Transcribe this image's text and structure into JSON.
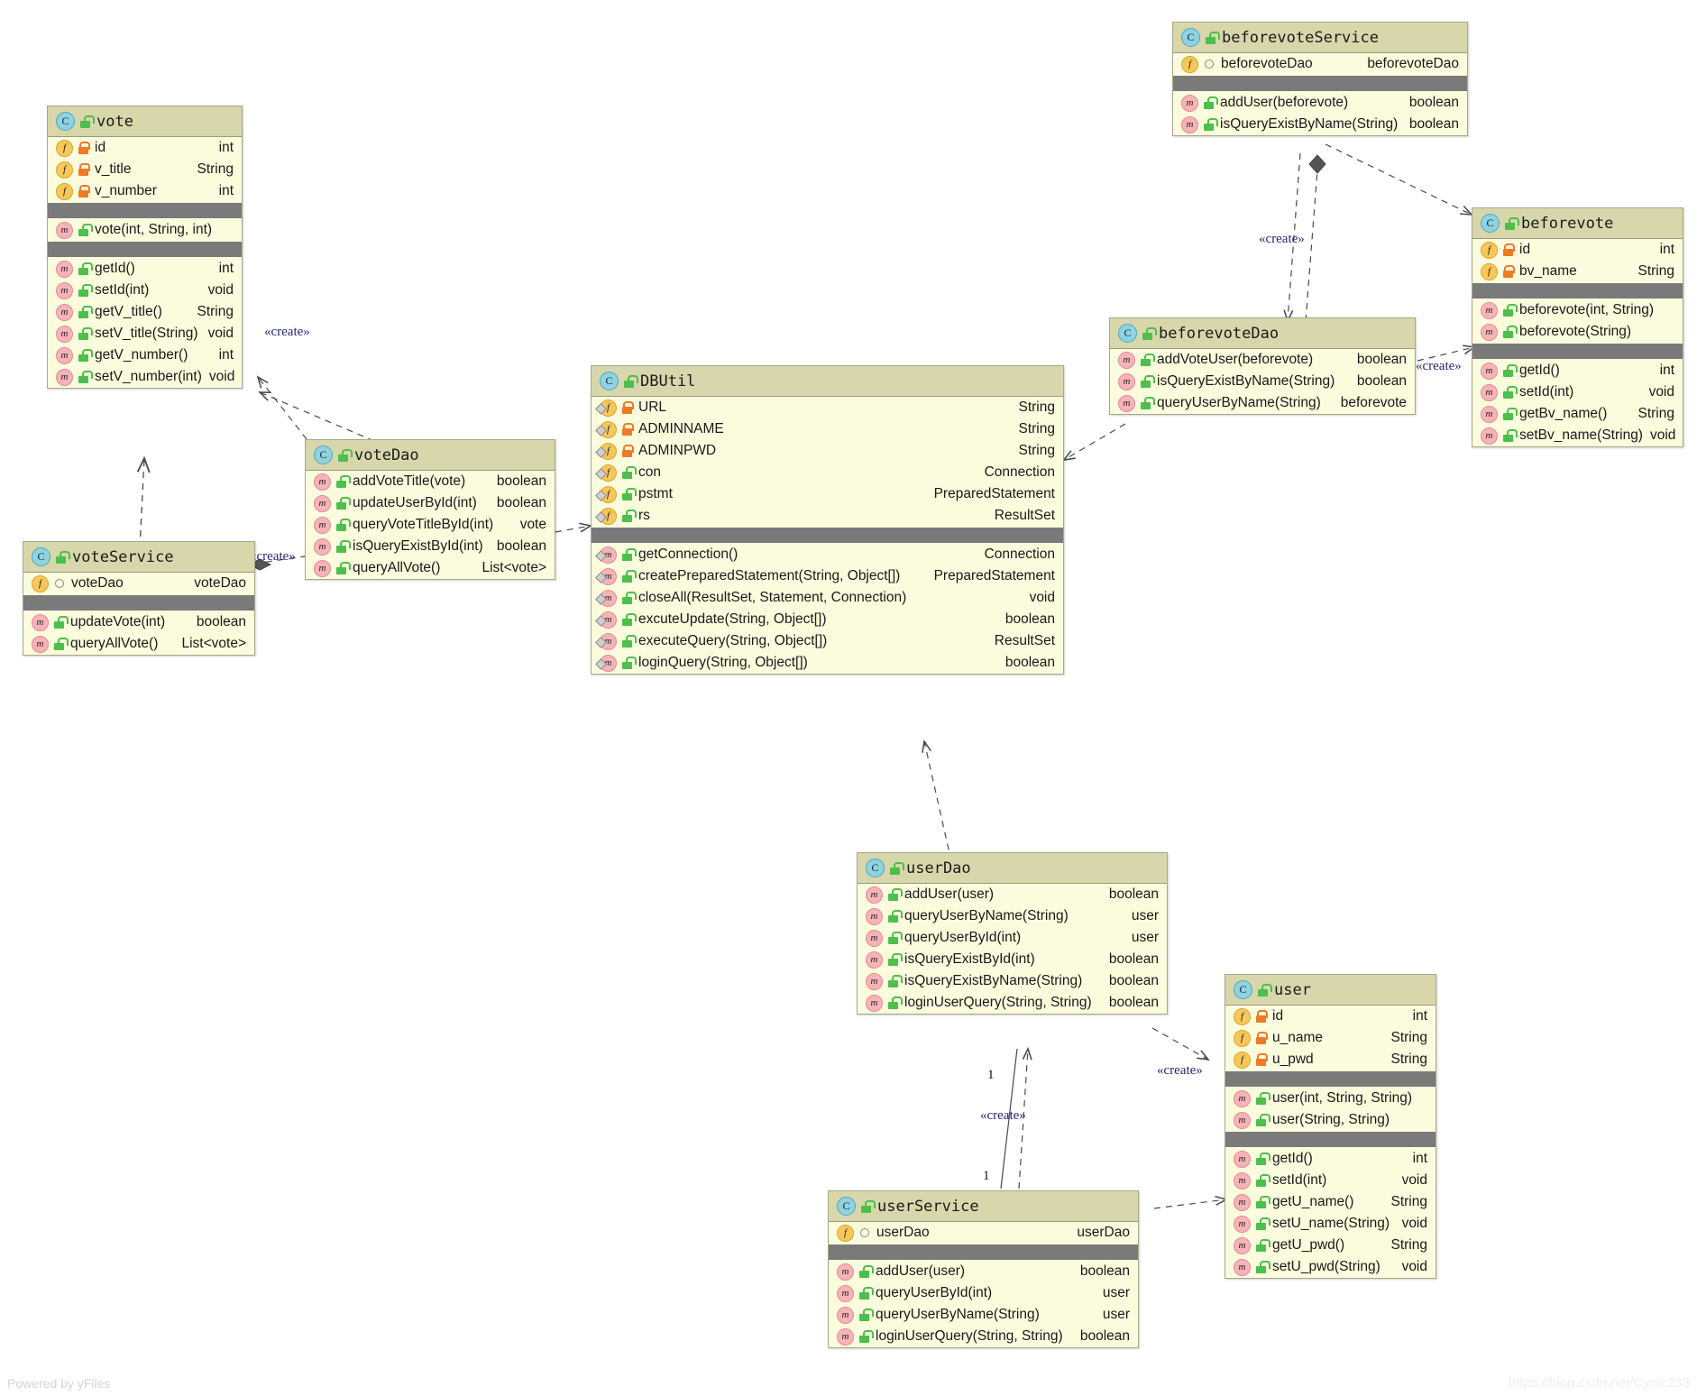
{
  "diagram": {
    "kind": "uml-class-diagram",
    "footer_left": "Powered by yFiles",
    "watermark": "https://blog.csdn.net/Cynic233",
    "colors": {
      "class_header": "#d7d7ab",
      "class_body": "#fbfbdd",
      "separator": "#7a7a7a",
      "border": "#a8a88c",
      "stereotype_text": "#26267a",
      "class_icon": "#8fd3e0",
      "field_icon": "#f7c75a",
      "method_icon": "#f7b3b8",
      "public_lock": "#4cbf4c",
      "private_lock": "#f07a26"
    }
  },
  "classes": {
    "vote": {
      "name": "vote",
      "fields": [
        {
          "name": "id",
          "type": "int",
          "vis": "private"
        },
        {
          "name": "v_title",
          "type": "String",
          "vis": "private"
        },
        {
          "name": "v_number",
          "type": "int",
          "vis": "private"
        }
      ],
      "constructors": [
        {
          "name": "vote(int, String, int)",
          "type": "",
          "vis": "public"
        }
      ],
      "methods": [
        {
          "name": "getId()",
          "type": "int",
          "vis": "public"
        },
        {
          "name": "setId(int)",
          "type": "void",
          "vis": "public"
        },
        {
          "name": "getV_title()",
          "type": "String",
          "vis": "public"
        },
        {
          "name": "setV_title(String)",
          "type": "void",
          "vis": "public"
        },
        {
          "name": "getV_number()",
          "type": "int",
          "vis": "public"
        },
        {
          "name": "setV_number(int)",
          "type": "void",
          "vis": "public"
        }
      ]
    },
    "voteService": {
      "name": "voteService",
      "fields": [
        {
          "name": "voteDao",
          "type": "voteDao",
          "vis": "package"
        }
      ],
      "methods": [
        {
          "name": "updateVote(int)",
          "type": "boolean",
          "vis": "public"
        },
        {
          "name": "queryAllVote()",
          "type": "List<vote>",
          "vis": "public"
        }
      ]
    },
    "voteDao": {
      "name": "voteDao",
      "methods": [
        {
          "name": "addVoteTitle(vote)",
          "type": "boolean",
          "vis": "public"
        },
        {
          "name": "updateUserById(int)",
          "type": "boolean",
          "vis": "public"
        },
        {
          "name": "queryVoteTitleById(int)",
          "type": "vote",
          "vis": "public"
        },
        {
          "name": "isQueryExistById(int)",
          "type": "boolean",
          "vis": "public"
        },
        {
          "name": "queryAllVote()",
          "type": "List<vote>",
          "vis": "public"
        }
      ]
    },
    "DBUtil": {
      "name": "DBUtil",
      "fields": [
        {
          "name": "URL",
          "type": "String",
          "vis": "private",
          "static": true
        },
        {
          "name": "ADMINNAME",
          "type": "String",
          "vis": "private",
          "static": true
        },
        {
          "name": "ADMINPWD",
          "type": "String",
          "vis": "private",
          "static": true
        },
        {
          "name": "con",
          "type": "Connection",
          "vis": "public",
          "static": true
        },
        {
          "name": "pstmt",
          "type": "PreparedStatement",
          "vis": "public",
          "static": true
        },
        {
          "name": "rs",
          "type": "ResultSet",
          "vis": "public",
          "static": true
        }
      ],
      "methods": [
        {
          "name": "getConnection()",
          "type": "Connection",
          "vis": "public",
          "static": true
        },
        {
          "name": "createPreparedStatement(String, Object[])",
          "type": "PreparedStatement",
          "vis": "public",
          "static": true
        },
        {
          "name": "closeAll(ResultSet, Statement, Connection)",
          "type": "void",
          "vis": "public",
          "static": true
        },
        {
          "name": "excuteUpdate(String, Object[])",
          "type": "boolean",
          "vis": "public",
          "static": true
        },
        {
          "name": "executeQuery(String, Object[])",
          "type": "ResultSet",
          "vis": "public",
          "static": true
        },
        {
          "name": "loginQuery(String, Object[])",
          "type": "boolean",
          "vis": "public",
          "static": true
        }
      ]
    },
    "beforevoteService": {
      "name": "beforevoteService",
      "fields": [
        {
          "name": "beforevoteDao",
          "type": "beforevoteDao",
          "vis": "package"
        }
      ],
      "methods": [
        {
          "name": "addUser(beforevote)",
          "type": "boolean",
          "vis": "public"
        },
        {
          "name": "isQueryExistByName(String)",
          "type": "boolean",
          "vis": "public"
        }
      ]
    },
    "beforevoteDao": {
      "name": "beforevoteDao",
      "methods": [
        {
          "name": "addVoteUser(beforevote)",
          "type": "boolean",
          "vis": "public"
        },
        {
          "name": "isQueryExistByName(String)",
          "type": "boolean",
          "vis": "public"
        },
        {
          "name": "queryUserByName(String)",
          "type": "beforevote",
          "vis": "public"
        }
      ]
    },
    "beforevote": {
      "name": "beforevote",
      "fields": [
        {
          "name": "id",
          "type": "int",
          "vis": "private"
        },
        {
          "name": "bv_name",
          "type": "String",
          "vis": "private"
        }
      ],
      "constructors": [
        {
          "name": "beforevote(int, String)",
          "type": "",
          "vis": "public"
        },
        {
          "name": "beforevote(String)",
          "type": "",
          "vis": "public"
        }
      ],
      "methods": [
        {
          "name": "getId()",
          "type": "int",
          "vis": "public"
        },
        {
          "name": "setId(int)",
          "type": "void",
          "vis": "public"
        },
        {
          "name": "getBv_name()",
          "type": "String",
          "vis": "public"
        },
        {
          "name": "setBv_name(String)",
          "type": "void",
          "vis": "public"
        }
      ]
    },
    "userDao": {
      "name": "userDao",
      "methods": [
        {
          "name": "addUser(user)",
          "type": "boolean",
          "vis": "public"
        },
        {
          "name": "queryUserByName(String)",
          "type": "user",
          "vis": "public"
        },
        {
          "name": "queryUserById(int)",
          "type": "user",
          "vis": "public"
        },
        {
          "name": "isQueryExistById(int)",
          "type": "boolean",
          "vis": "public"
        },
        {
          "name": "isQueryExistByName(String)",
          "type": "boolean",
          "vis": "public"
        },
        {
          "name": "loginUserQuery(String, String)",
          "type": "boolean",
          "vis": "public"
        }
      ]
    },
    "userService": {
      "name": "userService",
      "fields": [
        {
          "name": "userDao",
          "type": "userDao",
          "vis": "package"
        }
      ],
      "methods": [
        {
          "name": "addUser(user)",
          "type": "boolean",
          "vis": "public"
        },
        {
          "name": "queryUserById(int)",
          "type": "user",
          "vis": "public"
        },
        {
          "name": "queryUserByName(String)",
          "type": "user",
          "vis": "public"
        },
        {
          "name": "loginUserQuery(String, String)",
          "type": "boolean",
          "vis": "public"
        }
      ]
    },
    "user": {
      "name": "user",
      "fields": [
        {
          "name": "id",
          "type": "int",
          "vis": "private"
        },
        {
          "name": "u_name",
          "type": "String",
          "vis": "private"
        },
        {
          "name": "u_pwd",
          "type": "String",
          "vis": "private"
        }
      ],
      "constructors": [
        {
          "name": "user(int, String, String)",
          "type": "",
          "vis": "public"
        },
        {
          "name": "user(String, String)",
          "type": "",
          "vis": "public"
        }
      ],
      "methods": [
        {
          "name": "getId()",
          "type": "int",
          "vis": "public"
        },
        {
          "name": "setId(int)",
          "type": "void",
          "vis": "public"
        },
        {
          "name": "getU_name()",
          "type": "String",
          "vis": "public"
        },
        {
          "name": "setU_name(String)",
          "type": "void",
          "vis": "public"
        },
        {
          "name": "getU_pwd()",
          "type": "String",
          "vis": "public"
        },
        {
          "name": "setU_pwd(String)",
          "type": "void",
          "vis": "public"
        }
      ]
    }
  },
  "edges": {
    "labels": {
      "create_vote": "«create»",
      "create_voteservice": "«create»",
      "create_beforevote": "«create»",
      "create_beforevotedao": "«create»",
      "create_user": "«create»",
      "create_userservice": "«create»"
    },
    "multiplicities": {
      "user_top": "1",
      "user_bottom": "1"
    }
  }
}
